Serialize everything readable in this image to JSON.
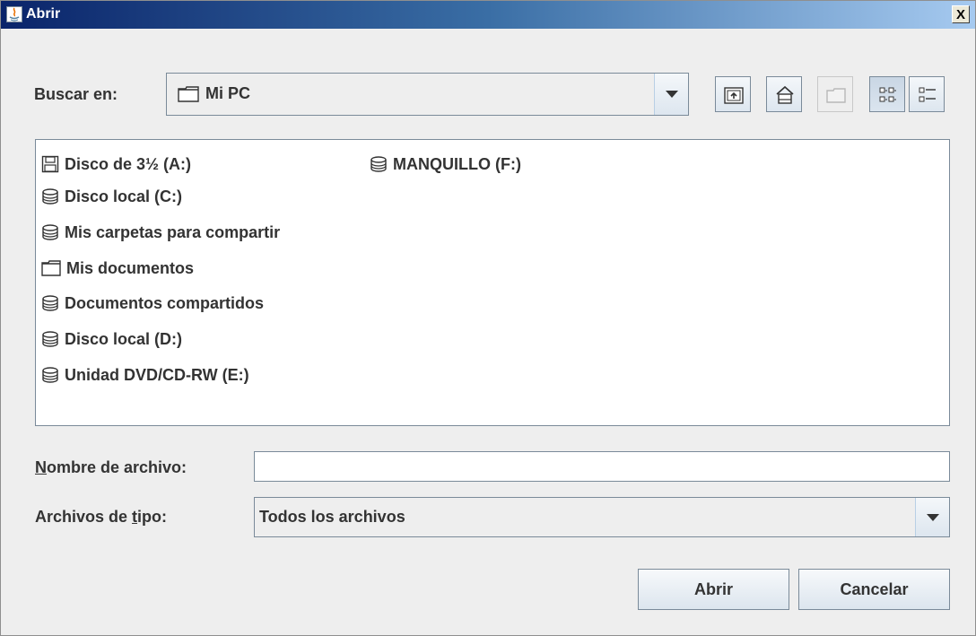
{
  "window": {
    "title": "Abrir",
    "close_label": "X"
  },
  "lookin": {
    "label": "Buscar en:",
    "value": "Mi PC"
  },
  "toolbar": {
    "icons": [
      "up-one-level-icon",
      "home-icon",
      "new-folder-icon",
      "list-view-icon",
      "details-view-icon"
    ]
  },
  "files": {
    "items": [
      {
        "label": "Disco de 3½ (A:)",
        "icon": "floppy-icon"
      },
      {
        "label": "Disco local (C:)",
        "icon": "drive-icon"
      },
      {
        "label": "Mis carpetas para compartir",
        "icon": "drive-icon"
      },
      {
        "label": "Mis documentos",
        "icon": "folder-icon"
      },
      {
        "label": "Documentos compartidos",
        "icon": "drive-icon"
      },
      {
        "label": "Disco local (D:)",
        "icon": "drive-icon"
      },
      {
        "label": "Unidad DVD/CD-RW (E:)",
        "icon": "drive-icon"
      },
      {
        "label": "MANQUILLO (F:)",
        "icon": "drive-icon"
      }
    ]
  },
  "filename": {
    "label_mnemonic": "N",
    "label_rest": "ombre de archivo:",
    "value": ""
  },
  "filetype": {
    "label_pre": "Archivos de ",
    "label_mnemonic": "t",
    "label_post": "ipo:",
    "value": "Todos los archivos"
  },
  "buttons": {
    "open": "Abrir",
    "cancel": "Cancelar"
  },
  "colors": {
    "title_start": "#0a246a",
    "title_end": "#a6caf0",
    "background": "#eeeeee",
    "border": "#7a8a99"
  }
}
